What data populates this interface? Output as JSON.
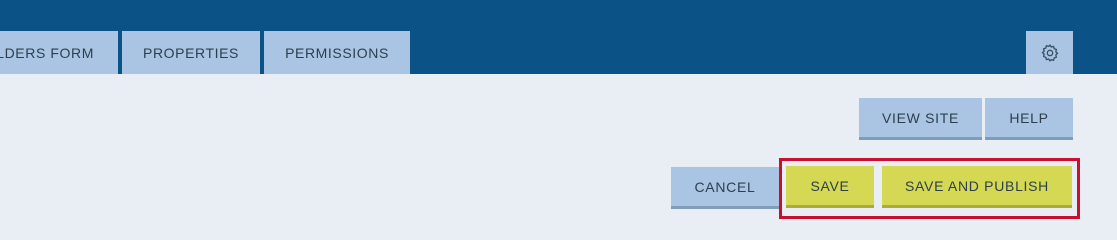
{
  "tabs": [
    {
      "label": "OLDERS FORM"
    },
    {
      "label": "PROPERTIES"
    },
    {
      "label": "PERMISSIONS"
    }
  ],
  "header": {
    "settings_icon": "gear-icon"
  },
  "actions": {
    "view_site": "VIEW SITE",
    "help": "HELP",
    "cancel": "CANCEL",
    "save": "SAVE",
    "save_and_publish": "SAVE AND PUBLISH"
  },
  "colors": {
    "header_bg": "#0b5387",
    "tab_bg": "#a9c5e3",
    "primary_button": "#d5d853",
    "highlight": "#c8102e",
    "page_bg": "#e8eef4"
  }
}
